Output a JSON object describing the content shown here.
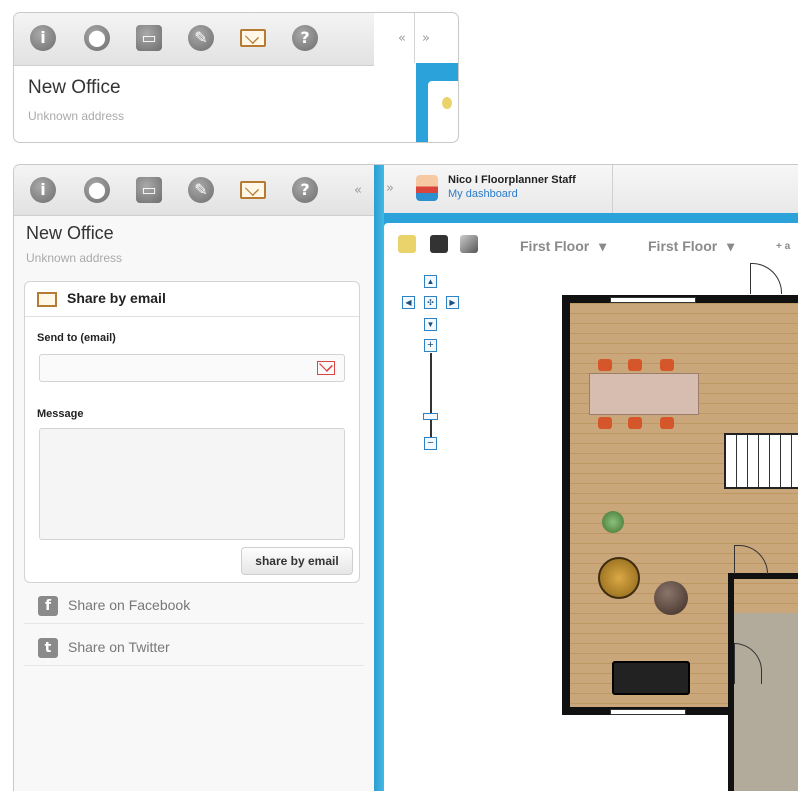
{
  "toolbar": {
    "icons": [
      "info-icon",
      "armchair-icon",
      "photo-icon",
      "paint-icon",
      "email-icon",
      "help-icon"
    ],
    "collapse_left": "«",
    "collapse_right": "»"
  },
  "project": {
    "title": "New Office",
    "address": "Unknown address"
  },
  "share_email": {
    "header": "Share by email",
    "send_to_label": "Send to (email)",
    "send_to_value": "",
    "message_label": "Message",
    "message_value": "",
    "button": "share by email"
  },
  "social": {
    "facebook": "Share on Facebook",
    "twitter": "Share on Twitter"
  },
  "user": {
    "name": "Nico I Floorplanner Staff",
    "link": "My dashboard"
  },
  "canvas": {
    "floor_selector_1": "First Floor",
    "floor_selector_2": "First Floor",
    "dropdown_glyph": "▾",
    "more_glyph": "+ a",
    "zoom_in": "+",
    "zoom_out": "−",
    "nav_up": "▲",
    "nav_down": "▼",
    "nav_left": "◀",
    "nav_right": "▶",
    "nav_center": "✣"
  },
  "colors": {
    "accent_blue": "#2ba2da",
    "email_icon": "#b77a32",
    "gmail_red": "#dd4444"
  }
}
